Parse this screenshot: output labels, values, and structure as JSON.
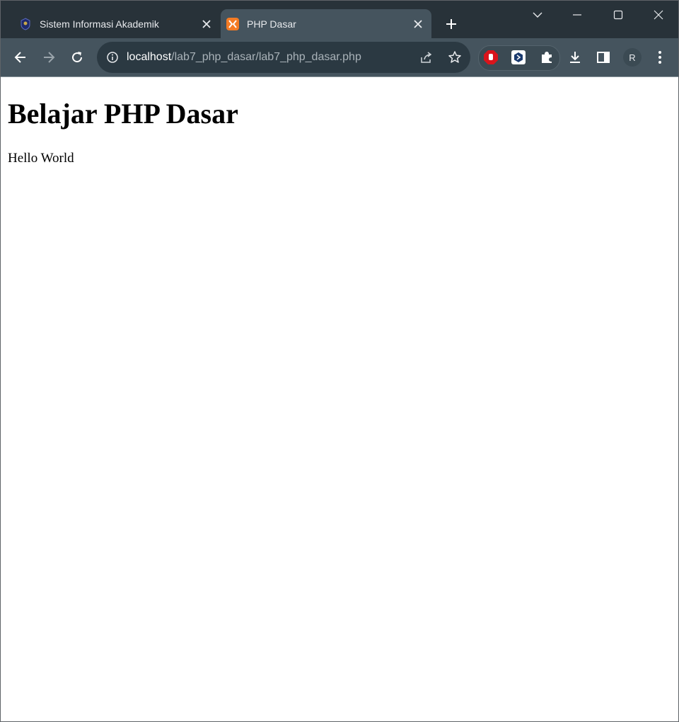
{
  "browser": {
    "tabs": [
      {
        "title": "Sistem Informasi Akademik",
        "favicon": "university-crest-icon",
        "active": false
      },
      {
        "title": "PHP Dasar",
        "favicon": "xampp-icon",
        "active": true
      }
    ],
    "address": {
      "host": "localhost",
      "path": "/lab7_php_dasar/lab7_php_dasar.php"
    },
    "profile_initial": "R",
    "colors": {
      "tabstrip": "#283239",
      "toolbar": "#45545e",
      "omnibox": "#2b3942",
      "xampp_orange": "#f47b24"
    }
  },
  "page": {
    "heading": "Belajar PHP Dasar",
    "text": "Hello World"
  }
}
